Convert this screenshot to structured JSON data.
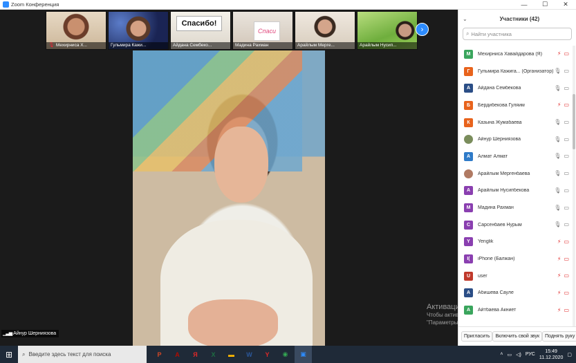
{
  "window": {
    "title": "Zoom Конференция",
    "min": "—",
    "max": "☐",
    "close": "✕"
  },
  "thumbnails": [
    {
      "label": "Мехирниса Х...",
      "muted": true
    },
    {
      "label": "Гульмира Кажи...",
      "muted": false
    },
    {
      "label": "Айдана Сембеко...",
      "muted": false,
      "sign": "Спасибо!"
    },
    {
      "label": "Мадина Рахман",
      "muted": false,
      "sign": "Спаси"
    },
    {
      "label": "Арайлым Мерге...",
      "muted": false
    },
    {
      "label": "Арайлым Нусип...",
      "muted": false
    }
  ],
  "active_speaker": {
    "label": "Айнур Шерниязова"
  },
  "watermark": {
    "line1": "Активация Windows",
    "line2": "Чтобы активировать Windows, перейдите в раздел",
    "line3": "\"Параметры\"."
  },
  "panel": {
    "title": "Участники (42)",
    "search_placeholder": "Найти участника",
    "participants": [
      {
        "initial": "М",
        "color": "#3aa55d",
        "name": "Мехирниса Хавайдарова (Я)",
        "mic": "muted",
        "cam": "off"
      },
      {
        "initial": "Г",
        "color": "#e8631c",
        "name": "Гульмира Кажига... (Организатор)",
        "mic": "on",
        "cam": "on"
      },
      {
        "initial": "А",
        "color": "#2b4e86",
        "name": "Айдана Сембекова",
        "mic": "on",
        "cam": "on"
      },
      {
        "initial": "Б",
        "color": "#e8631c",
        "name": "Бердибекова Гуляим",
        "mic": "muted",
        "cam": "off"
      },
      {
        "initial": "К",
        "color": "#e8631c",
        "name": "Казына Жумабаева",
        "mic": "on",
        "cam": "on"
      },
      {
        "initial": "",
        "color": "#7a8d5c",
        "name": "Айнур Шерниязова",
        "mic": "on",
        "cam": "on"
      },
      {
        "initial": "А",
        "color": "#2f7bc8",
        "name": "Алмат Алмат",
        "mic": "on",
        "cam": "on"
      },
      {
        "initial": "",
        "color": "#b07a63",
        "name": "Арайлым Мергенбаева",
        "mic": "on",
        "cam": "on"
      },
      {
        "initial": "А",
        "color": "#8a3fb0",
        "name": "Арайлым Нусипбекова",
        "mic": "on",
        "cam": "on"
      },
      {
        "initial": "М",
        "color": "#8a3fb0",
        "name": "Мадина Рахман",
        "mic": "on",
        "cam": "on"
      },
      {
        "initial": "С",
        "color": "#8a3fb0",
        "name": "Сарсенбаев Нурым",
        "mic": "on",
        "cam": "on"
      },
      {
        "initial": "Y",
        "color": "#8a3fb0",
        "name": "Yenglik",
        "mic": "muted",
        "cam": "off"
      },
      {
        "initial": "I(",
        "color": "#8a3fb0",
        "name": "iPhone (Балжан)",
        "mic": "muted",
        "cam": "off"
      },
      {
        "initial": "U",
        "color": "#c0392b",
        "name": "user",
        "mic": "muted",
        "cam": "off"
      },
      {
        "initial": "А",
        "color": "#2b4e86",
        "name": "Абишева Сауле",
        "mic": "muted",
        "cam": "off"
      },
      {
        "initial": "А",
        "color": "#3aa55d",
        "name": "Айтбаева Акниет",
        "mic": "muted",
        "cam": "off"
      }
    ],
    "buttons": {
      "invite": "Пригласить",
      "unmute": "Включить свой звук",
      "raise": "Поднять руку"
    }
  },
  "taskbar": {
    "search_placeholder": "Введите здесь текст для поиска",
    "apps": [
      "P",
      "A",
      "Я",
      "X",
      "▬",
      "W",
      "Y",
      "◉",
      "▣"
    ],
    "lang": "РУС",
    "time": "15:49",
    "date": "11.12.2020"
  }
}
